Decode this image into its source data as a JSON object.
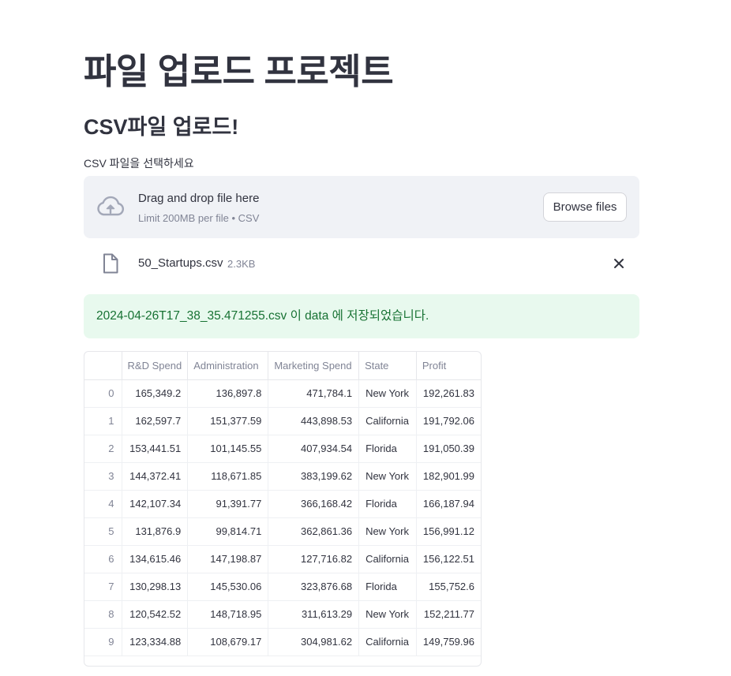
{
  "page": {
    "title": "파일 업로드 프로젝트",
    "subheader": "CSV파일 업로드!"
  },
  "uploader": {
    "label": "CSV 파일을 선택하세요",
    "drop_text": "Drag and drop file here",
    "limit_text": "Limit 200MB per file • CSV",
    "browse_label": "Browse files",
    "icons": [
      "cloud-upload-icon",
      "file-icon",
      "close-icon"
    ]
  },
  "uploaded_file": {
    "name": "50_Startups.csv",
    "size": "2.3KB"
  },
  "success_message": "2024-04-26T17_38_35.471255.csv 이 data 에 저장되었습니다.",
  "colors": {
    "text": "#31333f",
    "muted": "#808495",
    "dropzone_bg": "#f0f2f6",
    "success_bg": "#e8f9ee",
    "success_text": "#177233"
  },
  "table": {
    "columns": [
      "",
      "R&D Spend",
      "Administration",
      "Marketing Spend",
      "State",
      "Profit"
    ],
    "rows": [
      [
        "0",
        "165,349.2",
        "136,897.8",
        "471,784.1",
        "New York",
        "192,261.83"
      ],
      [
        "1",
        "162,597.7",
        "151,377.59",
        "443,898.53",
        "California",
        "191,792.06"
      ],
      [
        "2",
        "153,441.51",
        "101,145.55",
        "407,934.54",
        "Florida",
        "191,050.39"
      ],
      [
        "3",
        "144,372.41",
        "118,671.85",
        "383,199.62",
        "New York",
        "182,901.99"
      ],
      [
        "4",
        "142,107.34",
        "91,391.77",
        "366,168.42",
        "Florida",
        "166,187.94"
      ],
      [
        "5",
        "131,876.9",
        "99,814.71",
        "362,861.36",
        "New York",
        "156,991.12"
      ],
      [
        "6",
        "134,615.46",
        "147,198.87",
        "127,716.82",
        "California",
        "156,122.51"
      ],
      [
        "7",
        "130,298.13",
        "145,530.06",
        "323,876.68",
        "Florida",
        "155,752.6"
      ],
      [
        "8",
        "120,542.52",
        "148,718.95",
        "311,613.29",
        "New York",
        "152,211.77"
      ],
      [
        "9",
        "123,334.88",
        "108,679.17",
        "304,981.62",
        "California",
        "149,759.96"
      ]
    ]
  }
}
